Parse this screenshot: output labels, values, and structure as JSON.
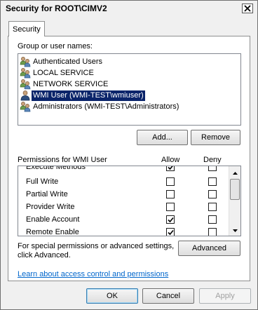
{
  "window": {
    "title": "Security for ROOT\\CIMV2",
    "close_icon": "close-icon"
  },
  "tabs": [
    {
      "label": "Security",
      "selected": true
    }
  ],
  "groups": {
    "label": "Group or user names:",
    "items": [
      {
        "label": "Authenticated Users",
        "icon": "users-icon",
        "selected": false
      },
      {
        "label": "LOCAL SERVICE",
        "icon": "users-icon",
        "selected": false
      },
      {
        "label": "NETWORK SERVICE",
        "icon": "users-icon",
        "selected": false
      },
      {
        "label": "WMI User (WMI-TEST\\wmiuser)",
        "icon": "user-icon",
        "selected": true
      },
      {
        "label": "Administrators (WMI-TEST\\Administrators)",
        "icon": "users-icon",
        "selected": false
      }
    ],
    "add_label": "Add...",
    "remove_label": "Remove"
  },
  "permissions": {
    "header_label": "Permissions for WMI User",
    "allow_label": "Allow",
    "deny_label": "Deny",
    "rows": [
      {
        "name": "Execute Methods",
        "allow": true,
        "deny": false
      },
      {
        "name": "Full Write",
        "allow": false,
        "deny": false
      },
      {
        "name": "Partial Write",
        "allow": false,
        "deny": false
      },
      {
        "name": "Provider Write",
        "allow": false,
        "deny": false
      },
      {
        "name": "Enable Account",
        "allow": true,
        "deny": false
      },
      {
        "name": "Remote Enable",
        "allow": true,
        "deny": false
      }
    ]
  },
  "advanced": {
    "text_line1": "For special permissions or advanced settings,",
    "text_line2": "click Advanced.",
    "button_label": "Advanced"
  },
  "help_link": "Learn about access control and permissions",
  "footer": {
    "ok_label": "OK",
    "cancel_label": "Cancel",
    "apply_label": "Apply"
  },
  "colors": {
    "selection": "#0a246a",
    "link": "#0066cc"
  }
}
